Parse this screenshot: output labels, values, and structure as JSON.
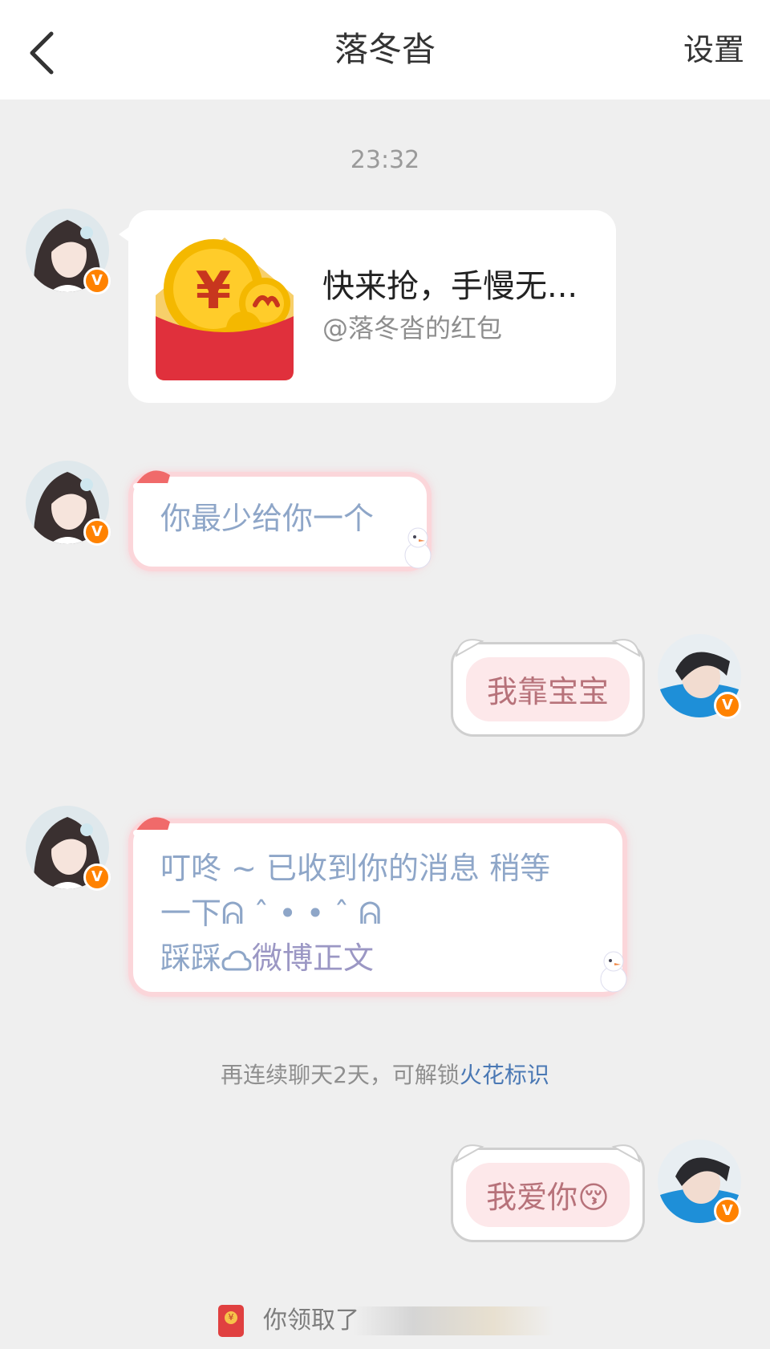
{
  "header": {
    "title": "落冬沓",
    "settings_label": "设置",
    "back_icon": "chevron-left-icon"
  },
  "messages": {
    "timestamp": "23:32",
    "red_packet": {
      "title": "快来抢，手慢无...",
      "subtitle": "@落冬沓的红包"
    },
    "msg1": "你最少给你一个",
    "msg2": "我靠宝宝",
    "msg3_line1": "叮咚 ~ 已收到你的消息 稍等",
    "msg3_line2": "一下ᕱ ˆ •  • ˆ ᕱ",
    "msg3_line3_a": "踩踩",
    "msg3_line3_link": "微博正文",
    "hint_text": "再连续聊天2天，可解锁",
    "hint_link": "火花标识",
    "msg4": "我爱你",
    "msg4_emoji": "😚",
    "packet_notice": "你领取了"
  },
  "colors": {
    "accent_orange": "#ff8200",
    "link_blue": "#4a78b4",
    "bubble_text_blue": "#8ea6c8",
    "bubble_text_pink": "#b7727a",
    "red_packet": "#e0303c"
  }
}
